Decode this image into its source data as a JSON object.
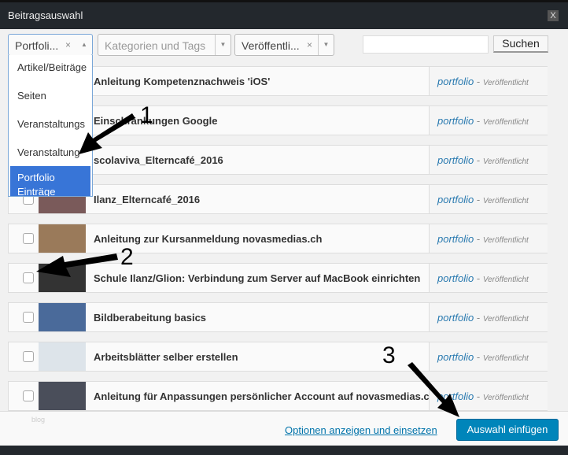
{
  "dialog": {
    "title": "Beitragsauswahl",
    "close_label": "X"
  },
  "filters": {
    "post_type": {
      "value": "Portfoli...",
      "clear": "×",
      "arrow": "▲"
    },
    "categories": {
      "placeholder": "Kategorien und Tags",
      "arrow": "▼"
    },
    "status": {
      "value": "Veröffentli...",
      "clear": "×",
      "arrow": "▼"
    },
    "search_value": "",
    "search_button": "Suchen"
  },
  "dropdown": {
    "options": [
      "Artikel/Beiträge",
      "Seiten",
      "Veranstaltungs",
      "Veranstaltung",
      "Portfolio Einträge"
    ],
    "selected_index": 4
  },
  "rows": [
    {
      "title": "Anleitung Kompetenznachweis 'iOS'",
      "type": "portfolio",
      "status": "Veröffentlicht",
      "thumb": "#c9c9c9"
    },
    {
      "title": "Einschränkungen Google",
      "type": "portfolio",
      "status": "Veröffentlicht",
      "thumb": "#bbb"
    },
    {
      "title": "scolaviva_Elterncafé_2016",
      "type": "portfolio",
      "status": "Veröffentlicht",
      "thumb": "#8a7a6a"
    },
    {
      "title": "Ilanz_Elterncafé_2016",
      "type": "portfolio",
      "status": "Veröffentlicht",
      "thumb": "#7a5a5a"
    },
    {
      "title": "Anleitung zur Kursanmeldung novasmedias.ch",
      "type": "portfolio",
      "status": "Veröffentlicht",
      "thumb": "#9a7a5a"
    },
    {
      "title": "Schule Ilanz/Glion: Verbindung zum Server auf MacBook einrichten",
      "type": "portfolio",
      "status": "Veröffentlicht",
      "thumb": "#333"
    },
    {
      "title": "Bildberabeitung basics",
      "type": "portfolio",
      "status": "Veröffentlicht",
      "thumb": "#4a6a9a"
    },
    {
      "title": "Arbeitsblätter selber erstellen",
      "type": "portfolio",
      "status": "Veröffentlicht",
      "thumb": "#dde4ea"
    },
    {
      "title": "Anleitung für Anpassungen persönlicher Account auf novasmedias.ch",
      "type": "portfolio",
      "status": "Veröffentlicht",
      "thumb": "#4a4e5a"
    }
  ],
  "footer": {
    "faded_label": "blog",
    "options_link": "Optionen anzeigen und einsetzen",
    "insert_button": "Auswahl einfügen"
  },
  "annotations": [
    "1",
    "2",
    "3"
  ]
}
